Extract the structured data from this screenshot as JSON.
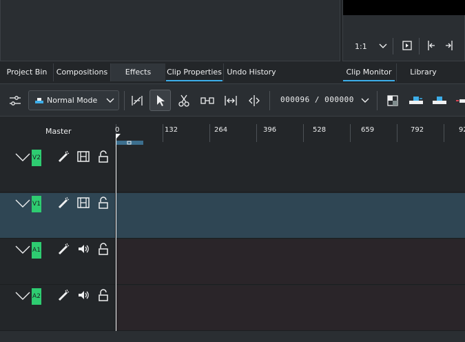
{
  "monitor": {
    "zoom_label": "1:1"
  },
  "tabs_left": [
    {
      "label": "Project Bin"
    },
    {
      "label": "Compositions"
    },
    {
      "label": "Effects"
    },
    {
      "label": "Clip Properties"
    },
    {
      "label": "Undo History"
    }
  ],
  "tabs_right": [
    {
      "label": "Clip Monitor"
    },
    {
      "label": "Library"
    }
  ],
  "toolbar": {
    "mode_label": "Normal Mode",
    "timecode": "000096 / 000000"
  },
  "timeline": {
    "master_label": "Master",
    "ruler_ticks": [
      "0",
      "132",
      "264",
      "396",
      "528",
      "659",
      "792",
      "92"
    ],
    "tracks": [
      {
        "tag": "V2",
        "kind": "video"
      },
      {
        "tag": "V1",
        "kind": "video"
      },
      {
        "tag": "A1",
        "kind": "audio"
      },
      {
        "tag": "A2",
        "kind": "audio"
      }
    ]
  },
  "colors": {
    "accent": "#3daee9",
    "track_tag": "#2ecc71",
    "selected_track": "#2f4654"
  }
}
